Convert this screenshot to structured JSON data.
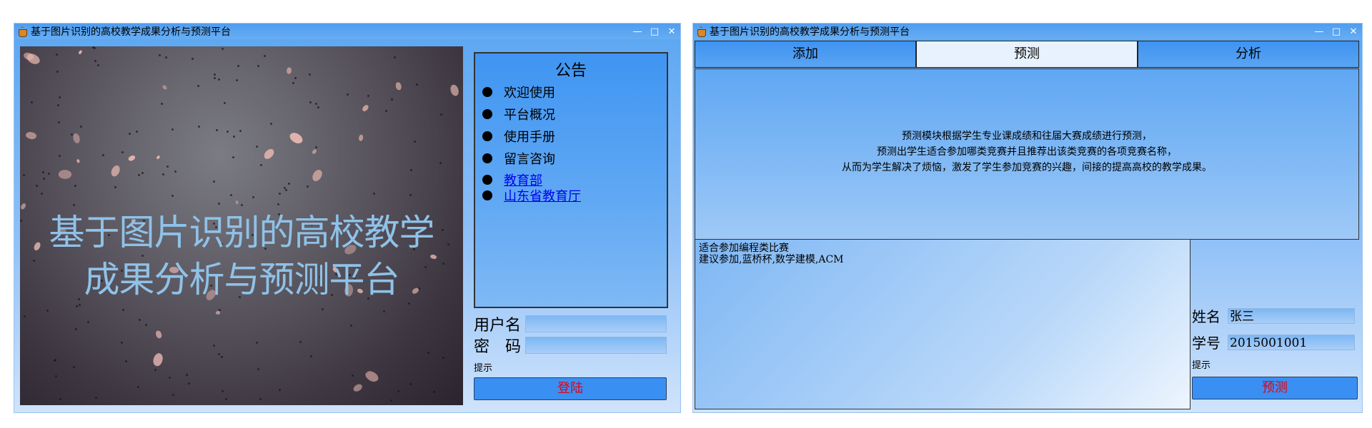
{
  "login_window": {
    "title": "基于图片识别的高校教学成果分析与预测平台",
    "window_controls": {
      "minimize": "—",
      "maximize": "□",
      "close": "✕"
    },
    "banner_text": "基于图片识别的高校教学成果分析与预测平台",
    "banner_line1": "基于图片识别的高校教学",
    "banner_line2": "成果分析与预测平台",
    "notice": {
      "title": "公告",
      "items": [
        "欢迎使用",
        "平台概况",
        "使用手册",
        "留言咨询"
      ],
      "links": [
        "教育部",
        "山东省教育厅"
      ]
    },
    "username_label": "用户名",
    "password_label": "密　码",
    "hint": "提示",
    "login_button": "登陆"
  },
  "predict_window": {
    "title": "基于图片识别的高校教学成果分析与预测平台",
    "window_controls": {
      "minimize": "—",
      "maximize": "□",
      "close": "✕"
    },
    "tabs": [
      {
        "label": "添加",
        "active": false
      },
      {
        "label": "预测",
        "active": true
      },
      {
        "label": "分析",
        "active": false
      }
    ],
    "description": [
      "预测模块根据学生专业课成绩和往届大赛成绩进行预测，",
      "预测出学生适合参加哪类竞赛并且推荐出该类竞赛的各项竞赛名称，",
      "从而为学生解决了烦恼，激发了学生参加竞赛的兴趣，间接的提高高校的教学成果。"
    ],
    "result": {
      "line1": "适合参加编程类比赛",
      "line2": "建议参加,蓝桥杯,数学建模,ACM"
    },
    "name_label": "姓名",
    "name_value": "张三",
    "id_label": "学号",
    "id_value": "2015001001",
    "hint": "提示",
    "predict_button": "预测"
  },
  "colors": {
    "window_bg": "#8fc0f7",
    "titlebar": "#5aa6f2",
    "button_bg": "#3a8ff2",
    "button_text": "#e60012",
    "link": "#0000ee",
    "banner_text": "#8fc2e8"
  }
}
